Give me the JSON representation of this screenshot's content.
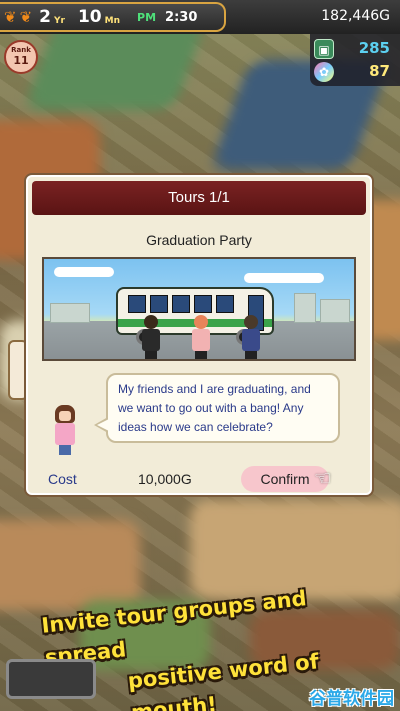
{
  "status_bar": {
    "year": "2",
    "year_unit": "Yr",
    "month": "10",
    "month_unit": "Mn",
    "ampm": "PM",
    "time": "2:30",
    "money": "182,446G",
    "leaf_icon": "maple-leaf-icon"
  },
  "rank": {
    "label": "Rank",
    "value": "11"
  },
  "resources": [
    {
      "icon": "ticket-icon",
      "value": "285",
      "color": "#5cd0f0"
    },
    {
      "icon": "medal-icon",
      "value": "87",
      "color": "#ffe97a"
    }
  ],
  "dialog": {
    "title": "Tours 1/1",
    "tour_name": "Graduation Party",
    "message": "My friends and I are graduating, and we want to go out with a bang! Any ideas how we can celebrate?",
    "cost_label": "Cost",
    "cost_value": "10,000G",
    "confirm_label": "Confirm",
    "hand_icon": "pointing-hand-icon"
  },
  "banner": {
    "line1": "Invite tour groups and spread",
    "line2": "positive word of mouth!"
  },
  "watermark": "谷普软件园",
  "colors": {
    "header_red": "#6a1a1a",
    "cost_blue": "#2a3a8a",
    "confirm_pink": "#f7c6cc",
    "banner_yellow": "#ffe23a"
  }
}
